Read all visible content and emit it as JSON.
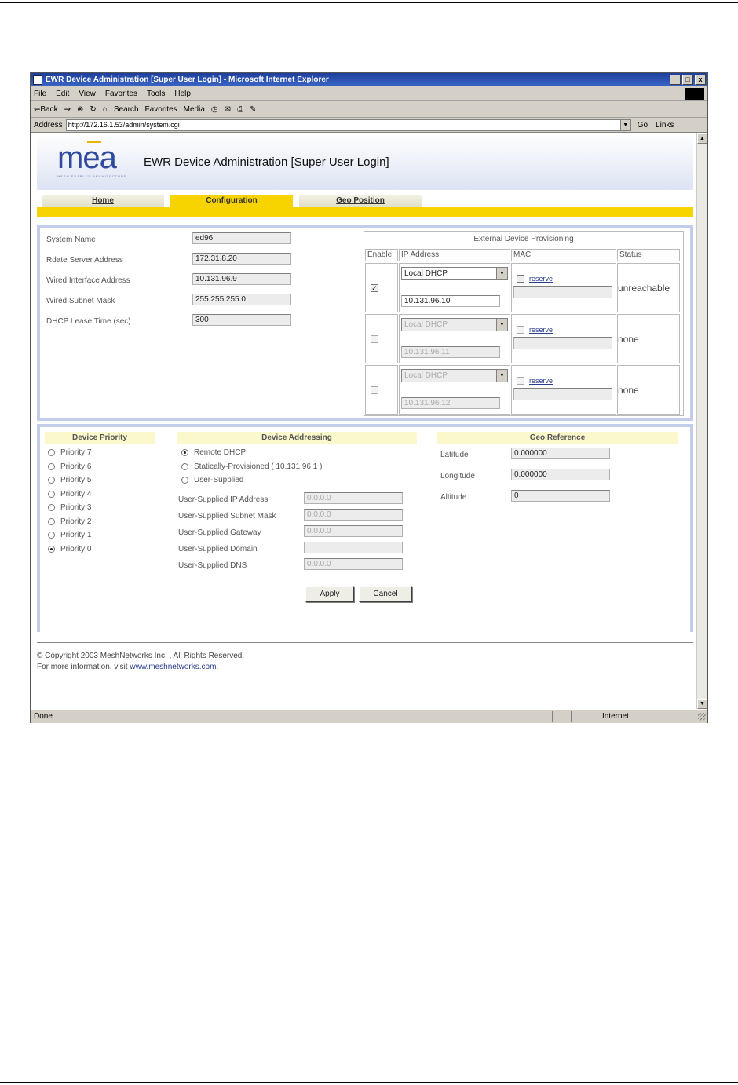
{
  "window": {
    "title": "EWR Device Administration [Super User Login] - Microsoft Internet Explorer",
    "btn_min": "_",
    "btn_max": "□",
    "btn_close": "x"
  },
  "menu": [
    "File",
    "Edit",
    "View",
    "Favorites",
    "Tools",
    "Help"
  ],
  "toolbar": {
    "back": "⇐Back",
    "forward": "⇒",
    "search": "Search",
    "favorites": "Favorites",
    "media": "Media"
  },
  "address": {
    "label": "Address",
    "url": "http://172.16.1.53/admin/system.cgi",
    "go": "Go",
    "links": "Links"
  },
  "app": {
    "logo": "mea",
    "logo_sub": "MESH ENABLED ARCHITECTURE",
    "title": "EWR Device Administration [Super User Login]",
    "tabs": {
      "home": "Home",
      "configuration": "Configuration",
      "geo": "Geo Position"
    }
  },
  "system": {
    "name_label": "System Name",
    "name_value": "ed96",
    "rdate_label": "Rdate Server Address",
    "rdate_value": "172.31.8.20",
    "wired_if_label": "Wired Interface Address",
    "wired_if_value": "10.131.96.9",
    "subnet_label": "Wired Subnet Mask",
    "subnet_value": "255.255.255.0",
    "dhcp_label": "DHCP Lease Time (sec)",
    "dhcp_value": "300"
  },
  "ext": {
    "caption": "External Device Provisioning",
    "col_enable": "Enable",
    "col_ip": "IP Address",
    "col_mac": "MAC",
    "col_status": "Status",
    "rows": [
      {
        "enabled": "✓",
        "mode": "Local DHCP",
        "ip": "10.131.96.10",
        "reserve": "reserve",
        "status": "unreachable"
      },
      {
        "enabled": "",
        "mode": "Local DHCP",
        "ip": "10.131.96.11",
        "reserve": "reserve",
        "status": "none"
      },
      {
        "enabled": "",
        "mode": "Local DHCP",
        "ip": "10.131.96.12",
        "reserve": "reserve",
        "status": "none"
      }
    ]
  },
  "priority": {
    "header": "Device Priority",
    "items": [
      "Priority 7",
      "Priority 6",
      "Priority 5",
      "Priority 4",
      "Priority 3",
      "Priority 2",
      "Priority 1",
      "Priority 0"
    ],
    "selected": "Priority 0"
  },
  "addressing": {
    "header": "Device Addressing",
    "options": [
      "Remote DHCP",
      "Statically-Provisioned ( 10.131.96.1 )",
      "User-Supplied"
    ],
    "selected": "Remote DHCP",
    "ip_label": "User-Supplied IP Address",
    "ip_value": "0.0.0.0",
    "mask_label": "User-Supplied Subnet Mask",
    "mask_value": "0.0.0.0",
    "gw_label": "User-Supplied Gateway",
    "gw_value": "0.0.0.0",
    "domain_label": "User-Supplied Domain",
    "domain_value": "",
    "dns_label": "User-Supplied DNS",
    "dns_value": "0.0.0.0"
  },
  "geo": {
    "header": "Geo Reference",
    "lat_label": "Latitude",
    "lat_value": "0.000000",
    "lon_label": "Longitude",
    "lon_value": "0.000000",
    "alt_label": "Altitude",
    "alt_value": "0"
  },
  "buttons": {
    "apply": "Apply",
    "cancel": "Cancel"
  },
  "footer": {
    "copyright": "© Copyright 2003 MeshNetworks Inc. , All Rights Reserved.",
    "more_prefix": "For more information, visit ",
    "link": "www.meshnetworks.com",
    "more_suffix": "."
  },
  "statusbar": {
    "left": "Done",
    "zone": "Internet"
  }
}
